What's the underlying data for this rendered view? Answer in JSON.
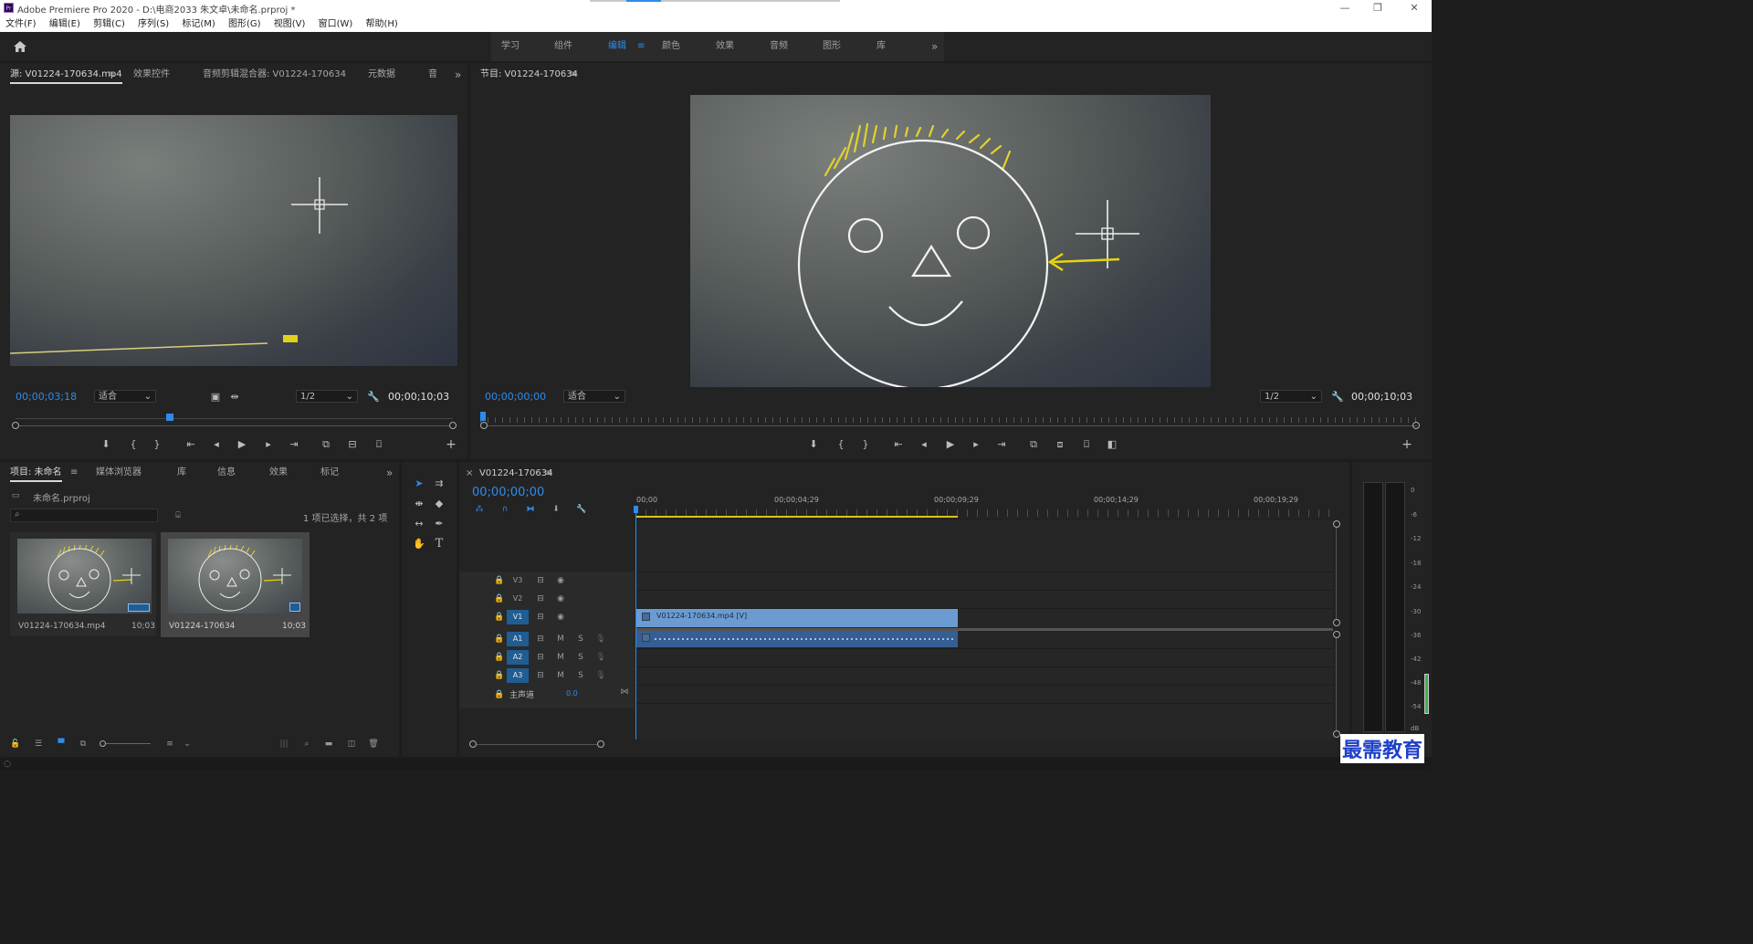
{
  "window": {
    "title": "Adobe Premiere Pro 2020 - D:\\电商2033 朱文卓\\未命名.prproj *",
    "minimize": "—",
    "maximize": "❐",
    "close": "✕"
  },
  "menu": [
    "文件(F)",
    "编辑(E)",
    "剪辑(C)",
    "序列(S)",
    "标记(M)",
    "图形(G)",
    "视图(V)",
    "窗口(W)",
    "帮助(H)"
  ],
  "workspaces": {
    "items": [
      "学习",
      "组件",
      "编辑",
      "颜色",
      "效果",
      "音频",
      "图形",
      "库"
    ],
    "active": "编辑",
    "more": "»"
  },
  "source": {
    "tabs": [
      "源: V01224-170634.mp4",
      "效果控件",
      "音频剪辑混合器: V01224-170634",
      "元数据",
      "音"
    ],
    "timecode": "00;00;03;18",
    "fit": "适合",
    "resolution": "1/2",
    "duration": "00;00;10;03",
    "playhead_fraction": 0.35,
    "menu_icon": "≡",
    "more": "»"
  },
  "program": {
    "title": "节目: V01224-170634",
    "timecode": "00;00;00;00",
    "fit": "适合",
    "resolution": "1/2",
    "duration": "00;00;10;03",
    "menu_icon": "≡"
  },
  "project": {
    "tabs": [
      "项目: 未命名",
      "媒体浏览器",
      "库",
      "信息",
      "效果",
      "标记"
    ],
    "file": "未命名.prproj",
    "selection_info": "1 项已选择，共 2 项",
    "items": [
      {
        "name": "V01224-170634.mp4",
        "duration": "10;03"
      },
      {
        "name": "V01224-170634",
        "duration": "10;03"
      }
    ],
    "more": "»"
  },
  "timeline": {
    "tab": "V01224-170634",
    "timecode": "00;00;00;00",
    "ruler": [
      "00;00",
      "00;00;04;29",
      "00;00;09;29",
      "00;00;14;29",
      "00;00;19;29"
    ],
    "video_tracks": [
      "V3",
      "V2",
      "V1"
    ],
    "audio_tracks": [
      "A1",
      "A2",
      "A3"
    ],
    "master": "主声道",
    "master_value": "0.0",
    "mute": "M",
    "solo": "S",
    "clip_label": "V01224-170634.mp4 [V]"
  },
  "meter": {
    "scale": [
      "0",
      "-6",
      "-12",
      "-18",
      "-24",
      "-30",
      "-36",
      "-42",
      "-48",
      "-54",
      "dB"
    ]
  },
  "watermark": "最需教育",
  "colors": {
    "accent": "#2d8ceb",
    "clip_video": "#6b9bd1",
    "clip_audio": "#355f92",
    "work_area": "#d6c51b"
  }
}
